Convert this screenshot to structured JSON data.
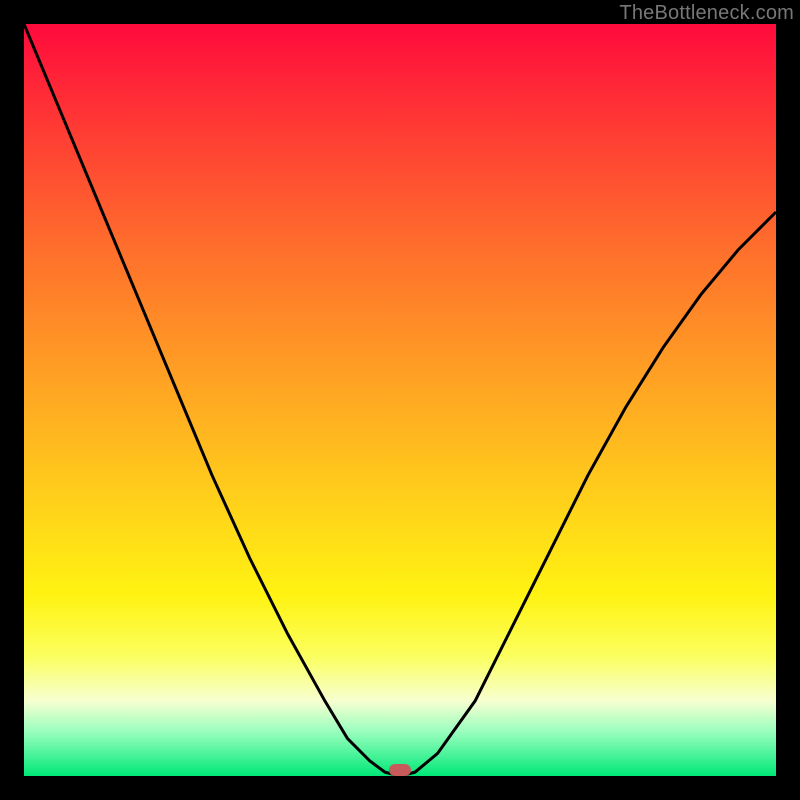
{
  "watermark": "TheBottleneck.com",
  "colors": {
    "frame_bg": "#000000",
    "curve_stroke": "#000000",
    "marker_fill": "#c75a5a",
    "gradient_top": "#ff0a3c",
    "gradient_bottom": "#00e878"
  },
  "chart_data": {
    "type": "line",
    "title": "",
    "xlabel": "",
    "ylabel": "",
    "xlim": [
      0,
      100
    ],
    "ylim": [
      0,
      100
    ],
    "grid": false,
    "legend": false,
    "annotations": [
      "TheBottleneck.com"
    ],
    "series": [
      {
        "name": "bottleneck-curve",
        "x": [
          0,
          5,
          10,
          15,
          20,
          25,
          30,
          35,
          40,
          43,
          46,
          48,
          50,
          52,
          55,
          60,
          65,
          70,
          75,
          80,
          85,
          90,
          95,
          100
        ],
        "y": [
          100,
          88,
          76,
          64,
          52,
          40,
          29,
          19,
          10,
          5,
          2,
          0.5,
          0,
          0.5,
          3,
          10,
          20,
          30,
          40,
          49,
          57,
          64,
          70,
          75
        ]
      }
    ],
    "minimum_marker": {
      "x": 50,
      "y": 0
    }
  }
}
